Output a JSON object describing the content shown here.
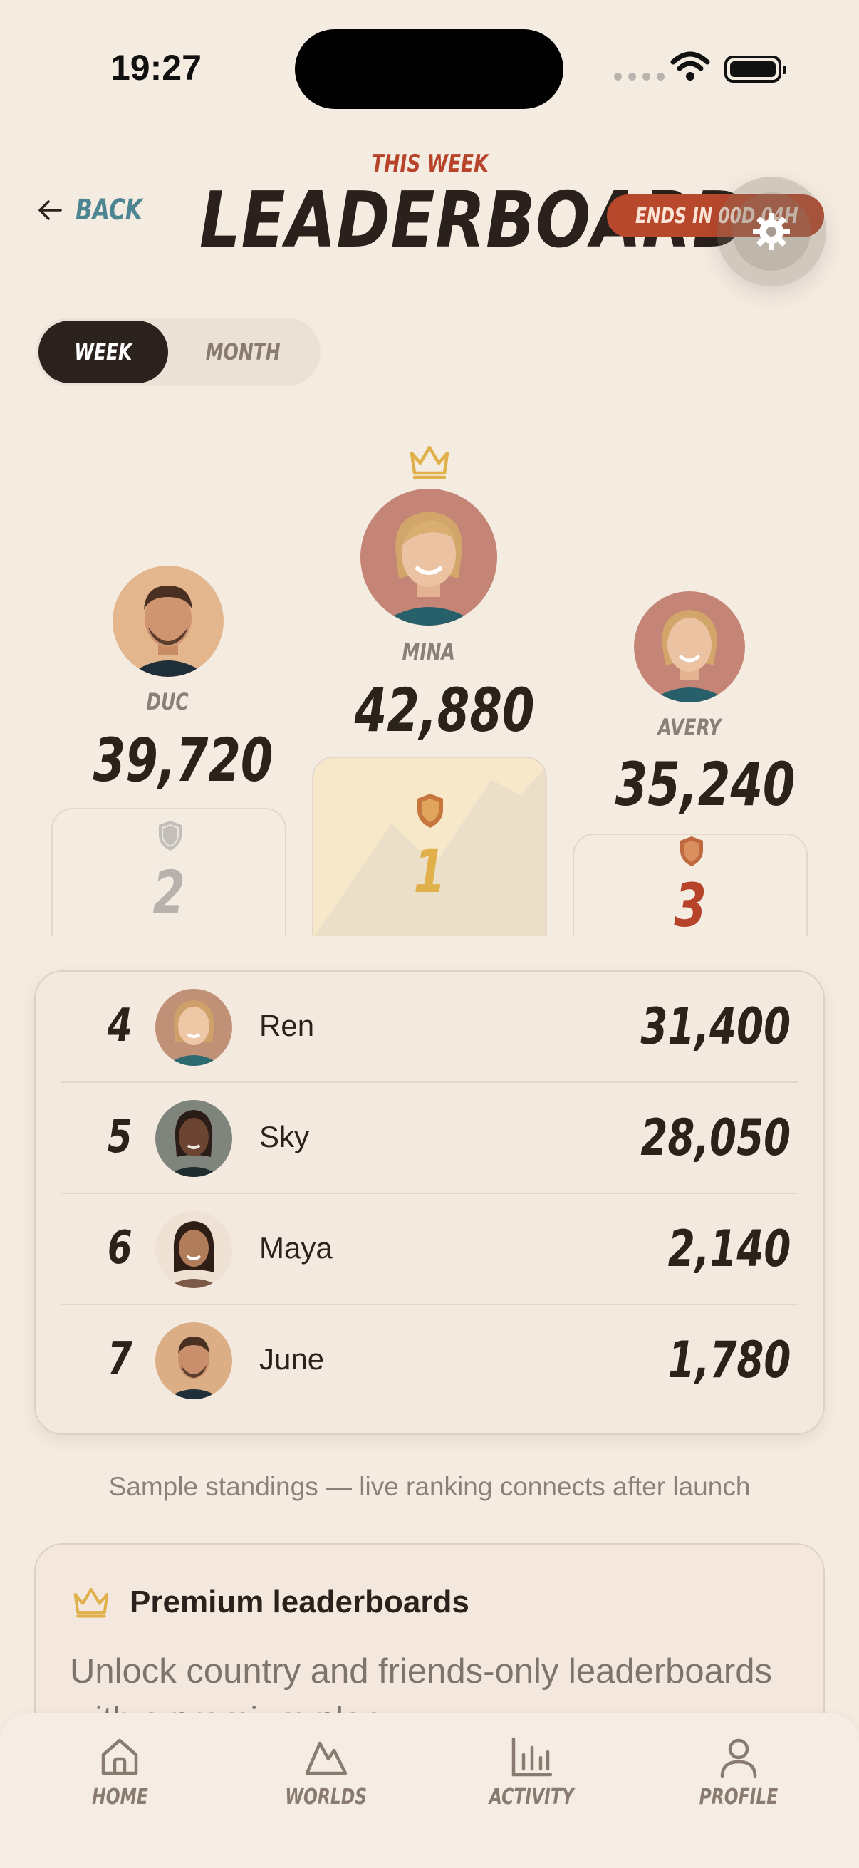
{
  "status_bar": {
    "time": "19:27"
  },
  "header": {
    "back_label": "BACK",
    "eyebrow": "THIS WEEK",
    "title": "LEADERBOARD",
    "ends_label": "ENDS IN 00D 04H"
  },
  "period_toggle": {
    "options": [
      "WEEK",
      "MONTH"
    ],
    "selected": "WEEK"
  },
  "podium": [
    {
      "rank": "2",
      "name": "DUC",
      "score": "39,720"
    },
    {
      "rank": "1",
      "name": "MINA",
      "score": "42,880"
    },
    {
      "rank": "3",
      "name": "AVERY",
      "score": "35,240"
    }
  ],
  "standings": [
    {
      "rank": "4",
      "name": "Ren",
      "score": "31,400"
    },
    {
      "rank": "5",
      "name": "Sky",
      "score": "28,050"
    },
    {
      "rank": "6",
      "name": "Maya",
      "score": "2,140"
    },
    {
      "rank": "7",
      "name": "June",
      "score": "1,780"
    }
  ],
  "note": "Sample standings — live ranking connects after launch",
  "premium": {
    "title": "Premium leaderboards",
    "description": "Unlock country and friends-only leaderboards with a premium plan."
  },
  "tabs": [
    {
      "label": "HOME",
      "icon": "home-icon"
    },
    {
      "label": "WORLDS",
      "icon": "mountain-icon"
    },
    {
      "label": "ACTIVITY",
      "icon": "bar-chart-icon"
    },
    {
      "label": "PROFILE",
      "icon": "person-icon"
    }
  ],
  "colors": {
    "accent": "#b8482c",
    "gold": "#e0b04a",
    "link": "#4e8592",
    "dark": "#2b221d"
  }
}
